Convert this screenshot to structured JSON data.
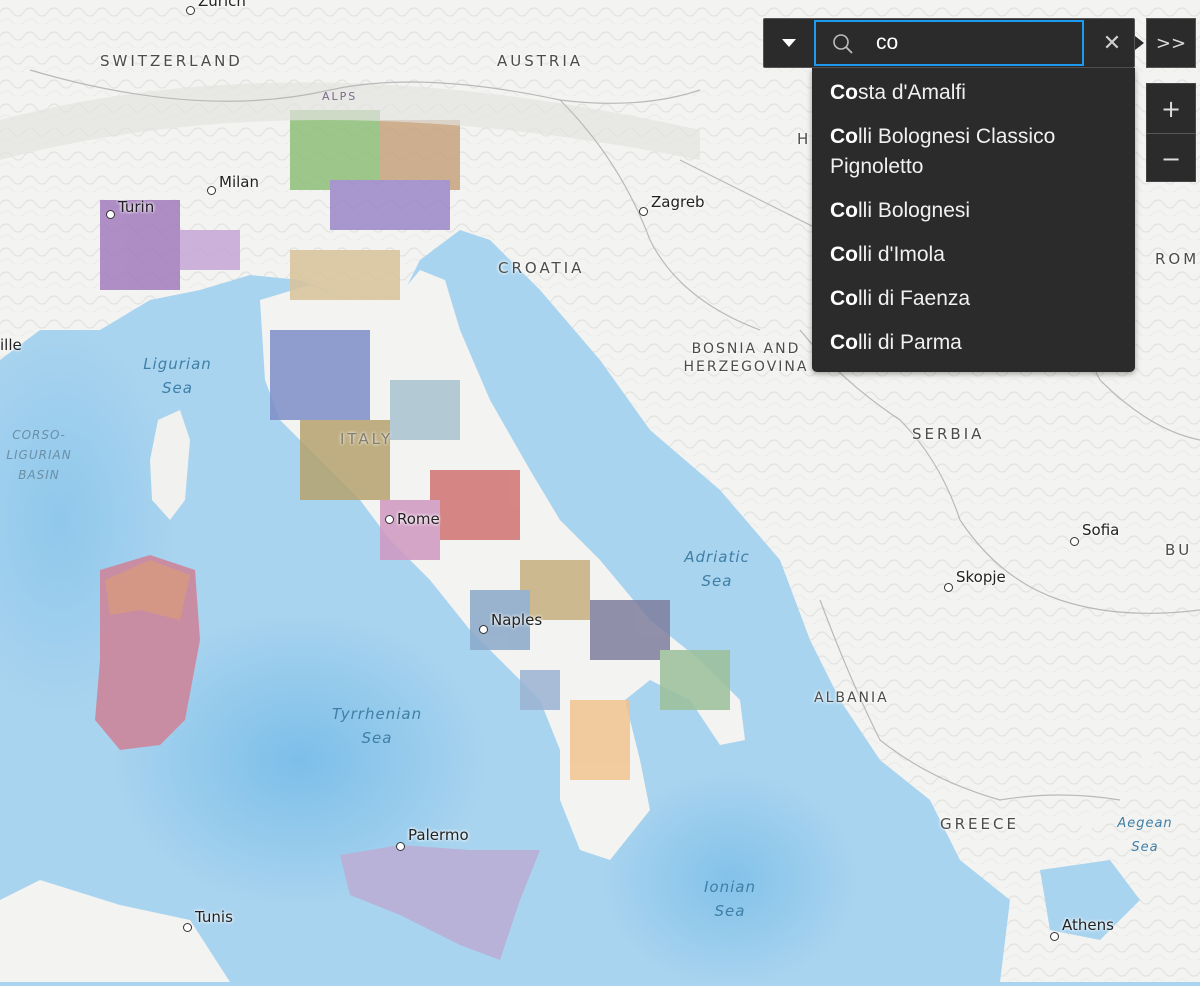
{
  "search": {
    "value": "co",
    "menu_icon": "caret-down-icon",
    "search_icon": "magnifier-icon",
    "clear_icon": "close-icon",
    "suggestions": [
      {
        "match": "Co",
        "rest": "sta d'Amalfi"
      },
      {
        "match": "Co",
        "rest": "lli Bolognesi Classico Pignoletto"
      },
      {
        "match": "Co",
        "rest": "lli Bolognesi"
      },
      {
        "match": "Co",
        "rest": "lli d'Imola"
      },
      {
        "match": "Co",
        "rest": "lli di Faenza"
      },
      {
        "match": "Co",
        "rest": "lli di Parma"
      }
    ]
  },
  "controls": {
    "expand_label": ">>",
    "zoom_in_label": "+",
    "zoom_out_label": "−"
  },
  "map": {
    "countries": {
      "switzerland": "SWITZERLAND",
      "austria": "AUSTRIA",
      "croatia": "CROATIA",
      "bosnia": "BOSNIA AND HERZEGOVINA",
      "serbia": "SERBIA",
      "albania": "ALBANIA",
      "greece": "GREECE",
      "italy": "ITALY",
      "romania_partial": "ROM",
      "bulgaria_partial": "BU",
      "hungary_partial": "H"
    },
    "seas": {
      "ligurian": "Ligurian Sea",
      "adriatic": "Adriatic Sea",
      "tyrrhenian": "Tyrrhenian Sea",
      "ionian": "Ionian Sea",
      "aegean": "Aegean Sea",
      "corso": "CORSO- LIGURIAN BASIN"
    },
    "cities": {
      "zurich": "Zurich",
      "milan": "Milan",
      "turin": "Turin",
      "zagreb": "Zagreb",
      "rome": "Rome",
      "naples": "Naples",
      "palermo": "Palermo",
      "tunis": "Tunis",
      "sofia": "Sofia",
      "skopje": "Skopje",
      "athens": "Athens",
      "marseille_partial": "ille"
    },
    "other_labels": {
      "alps": "ALPS"
    },
    "colors": {
      "sea": "#a9d4ef",
      "land": "#f3f3f1",
      "widget": "#2b2b2b",
      "focus": "#1d9bf0"
    }
  }
}
